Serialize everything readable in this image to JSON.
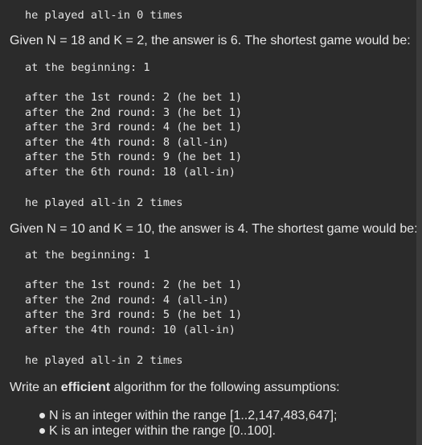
{
  "content": {
    "top_line": "he played all-in 0 times",
    "example1": {
      "intro": "Given N = 18 and K = 2, the answer is 6. The shortest game would be:",
      "beginning": "at the beginning: 1",
      "rounds": [
        "after the 1st round: 2 (he bet 1)",
        "after the 2nd round: 3 (he bet 1)",
        "after the 3rd round: 4 (he bet 1)",
        "after the 4th round: 8 (all-in)",
        "after the 5th round: 9 (he bet 1)",
        "after the 6th round: 18 (all-in)"
      ],
      "summary": "he played all-in 2 times"
    },
    "example2": {
      "intro": "Given N = 10 and K = 10, the answer is 4. The shortest game would be:",
      "beginning": "at the beginning: 1",
      "rounds": [
        "after the 1st round: 2 (he bet 1)",
        "after the 2nd round: 4 (all-in)",
        "after the 3rd round: 5 (he bet 1)",
        "after the 4th round: 10 (all-in)"
      ],
      "summary": "he played all-in 2 times"
    },
    "task": {
      "prefix": "Write an ",
      "emphasis": "efficient",
      "suffix": " algorithm for the following assumptions:"
    },
    "assumptions": [
      "N is an integer within the range [1..2,147,483,647];",
      "K is an integer within the range [0..100]."
    ]
  }
}
